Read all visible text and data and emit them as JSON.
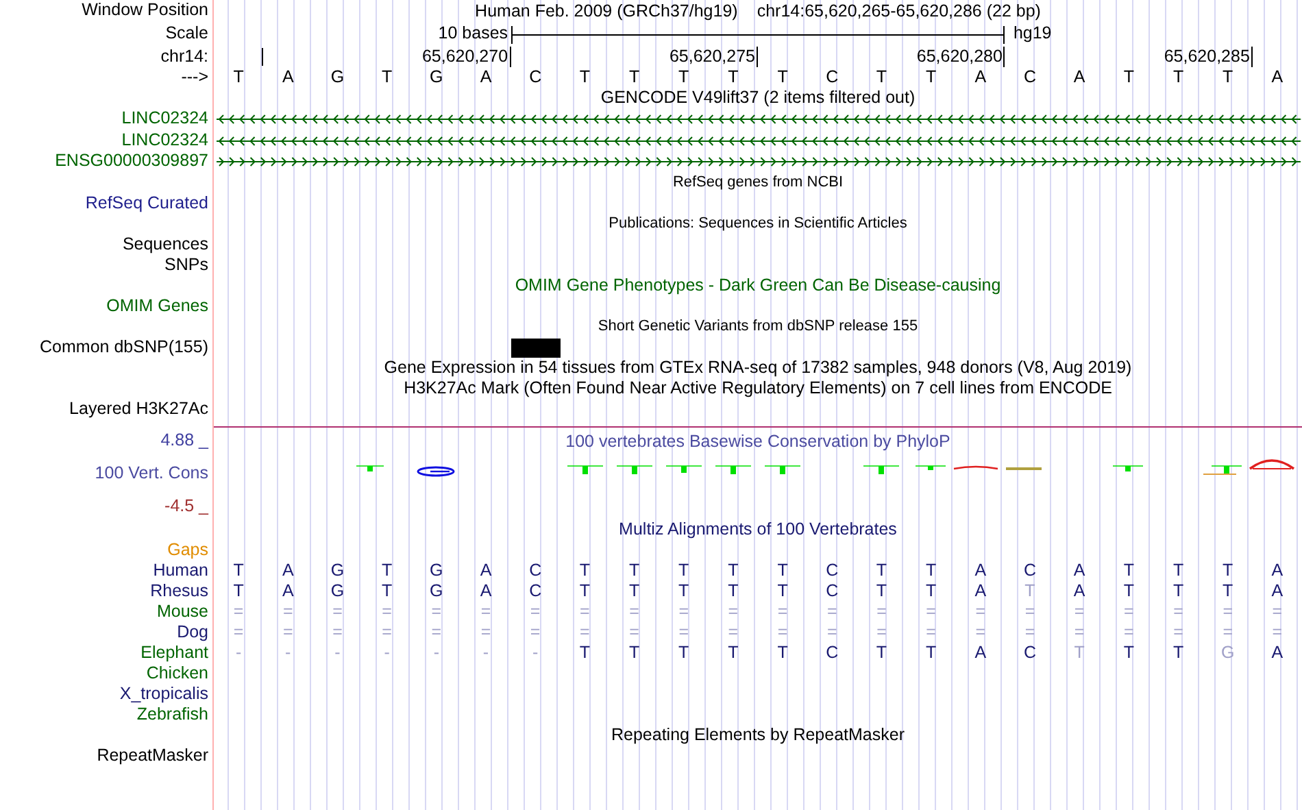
{
  "header": {
    "label": "Window Position",
    "assembly": "Human Feb. 2009 (GRCh37/hg19)",
    "position": "chr14:65,620,265-65,620,286 (22 bp)"
  },
  "scale": {
    "label": "Scale",
    "length": "10 bases",
    "assembly": "hg19"
  },
  "ruler": {
    "label": "chr14:",
    "ticks": [
      "65,620,270",
      "65,620,275",
      "65,620,280",
      "65,620,285"
    ]
  },
  "sequence": {
    "label": "--->",
    "bases": [
      "T",
      "A",
      "G",
      "T",
      "G",
      "A",
      "C",
      "T",
      "T",
      "T",
      "T",
      "T",
      "C",
      "T",
      "T",
      "A",
      "C",
      "A",
      "T",
      "T",
      "T",
      "A"
    ]
  },
  "gencode": {
    "title": "GENCODE V49lift37 (2 items filtered out)",
    "genes": [
      {
        "name": "LINC02324",
        "kind": "minus",
        "color": "#006400"
      },
      {
        "name": "LINC02324",
        "kind": "minus",
        "color": "#006400"
      },
      {
        "name": "ENSG00000309897",
        "kind": "plus",
        "color": "#006400"
      }
    ]
  },
  "tracks": [
    {
      "kind": "note",
      "titles": [
        {
          "text": "RefSeq genes from NCBI",
          "color": "#000000"
        }
      ],
      "labels": [
        {
          "text": "RefSeq Curated",
          "color": "#1e1e8c",
          "kind": "plain"
        }
      ]
    },
    {
      "kind": "note",
      "titles": [
        {
          "text": "Publications: Sequences in Scientific Articles",
          "color": "#000000"
        }
      ],
      "labels": [
        {
          "text": "Sequences",
          "color": "#000000",
          "kind": "plain"
        },
        {
          "text": "SNPs",
          "color": "#000000",
          "kind": "plain"
        }
      ]
    },
    {
      "kind": "heading",
      "titles": [
        {
          "text": "OMIM Gene Phenotypes - Dark Green Can Be Disease-causing",
          "color": "#006400"
        }
      ],
      "labels": [
        {
          "text": "OMIM Genes",
          "color": "#006400",
          "kind": "plain"
        }
      ]
    },
    {
      "kind": "note",
      "titles": [
        {
          "text": "Short Genetic Variants from dbSNP release 155",
          "color": "#000000"
        }
      ],
      "labels": [
        {
          "text": "Common dbSNP(155)",
          "color": "#000000",
          "kind": "variant"
        }
      ]
    },
    {
      "kind": "heading",
      "titles": [
        {
          "text": "Gene Expression in 54 tissues from GTEx RNA-seq of 17382 samples, 948 donors (V8, Aug 2019)",
          "color": "#000000"
        },
        {
          "text": "H3K27Ac Mark (Often Found Near Active Regulatory Elements) on 7 cell lines from ENCODE",
          "color": "#000000"
        }
      ],
      "labels": [
        {
          "text": "Layered H3K27Ac",
          "color": "#000000",
          "kind": "tall"
        }
      ]
    }
  ],
  "conservation": {
    "title": "100 vertebrates Basewise Conservation by PhyloP",
    "max": "4.88 _",
    "label": "100 Vert. Cons",
    "min": "-4.5 _"
  },
  "multiz": {
    "title": "Multiz Alignments of 100 Vertebrates",
    "gaps_label": "Gaps",
    "species": [
      {
        "name": "Human",
        "color": "#191970",
        "bases": [
          {
            "base": "T",
            "faint": false
          },
          {
            "base": "A",
            "faint": false
          },
          {
            "base": "G",
            "faint": false
          },
          {
            "base": "T",
            "faint": false
          },
          {
            "base": "G",
            "faint": false
          },
          {
            "base": "A",
            "faint": false
          },
          {
            "base": "C",
            "faint": false
          },
          {
            "base": "T",
            "faint": false
          },
          {
            "base": "T",
            "faint": false
          },
          {
            "base": "T",
            "faint": false
          },
          {
            "base": "T",
            "faint": false
          },
          {
            "base": "T",
            "faint": false
          },
          {
            "base": "C",
            "faint": false
          },
          {
            "base": "T",
            "faint": false
          },
          {
            "base": "T",
            "faint": false
          },
          {
            "base": "A",
            "faint": false
          },
          {
            "base": "C",
            "faint": false
          },
          {
            "base": "A",
            "faint": false
          },
          {
            "base": "T",
            "faint": false
          },
          {
            "base": "T",
            "faint": false
          },
          {
            "base": "T",
            "faint": false
          },
          {
            "base": "A",
            "faint": false
          }
        ]
      },
      {
        "name": "Rhesus",
        "color": "#191970",
        "bases": [
          {
            "base": "T",
            "faint": false
          },
          {
            "base": "A",
            "faint": false
          },
          {
            "base": "G",
            "faint": false
          },
          {
            "base": "T",
            "faint": false
          },
          {
            "base": "G",
            "faint": false
          },
          {
            "base": "A",
            "faint": false
          },
          {
            "base": "C",
            "faint": false
          },
          {
            "base": "T",
            "faint": false
          },
          {
            "base": "T",
            "faint": false
          },
          {
            "base": "T",
            "faint": false
          },
          {
            "base": "T",
            "faint": false
          },
          {
            "base": "T",
            "faint": false
          },
          {
            "base": "C",
            "faint": false
          },
          {
            "base": "T",
            "faint": false
          },
          {
            "base": "T",
            "faint": false
          },
          {
            "base": "A",
            "faint": false
          },
          {
            "base": "T",
            "faint": true
          },
          {
            "base": "A",
            "faint": false
          },
          {
            "base": "T",
            "faint": false
          },
          {
            "base": "T",
            "faint": false
          },
          {
            "base": "T",
            "faint": false
          },
          {
            "base": "A",
            "faint": false
          }
        ]
      },
      {
        "name": "Mouse",
        "color": "#006400",
        "bases": [
          {
            "base": "=",
            "faint": true
          },
          {
            "base": "=",
            "faint": true
          },
          {
            "base": "=",
            "faint": true
          },
          {
            "base": "=",
            "faint": true
          },
          {
            "base": "=",
            "faint": true
          },
          {
            "base": "=",
            "faint": true
          },
          {
            "base": "=",
            "faint": true
          },
          {
            "base": "=",
            "faint": true
          },
          {
            "base": "=",
            "faint": true
          },
          {
            "base": "=",
            "faint": true
          },
          {
            "base": "=",
            "faint": true
          },
          {
            "base": "=",
            "faint": true
          },
          {
            "base": "=",
            "faint": true
          },
          {
            "base": "=",
            "faint": true
          },
          {
            "base": "=",
            "faint": true
          },
          {
            "base": "=",
            "faint": true
          },
          {
            "base": "=",
            "faint": true
          },
          {
            "base": "=",
            "faint": true
          },
          {
            "base": "=",
            "faint": true
          },
          {
            "base": "=",
            "faint": true
          },
          {
            "base": "=",
            "faint": true
          },
          {
            "base": "=",
            "faint": true
          }
        ]
      },
      {
        "name": "Dog",
        "color": "#191970",
        "bases": [
          {
            "base": "=",
            "faint": true
          },
          {
            "base": "=",
            "faint": true
          },
          {
            "base": "=",
            "faint": true
          },
          {
            "base": "=",
            "faint": true
          },
          {
            "base": "=",
            "faint": true
          },
          {
            "base": "=",
            "faint": true
          },
          {
            "base": "=",
            "faint": true
          },
          {
            "base": "=",
            "faint": true
          },
          {
            "base": "=",
            "faint": true
          },
          {
            "base": "=",
            "faint": true
          },
          {
            "base": "=",
            "faint": true
          },
          {
            "base": "=",
            "faint": true
          },
          {
            "base": "=",
            "faint": true
          },
          {
            "base": "=",
            "faint": true
          },
          {
            "base": "=",
            "faint": true
          },
          {
            "base": "=",
            "faint": true
          },
          {
            "base": "=",
            "faint": true
          },
          {
            "base": "=",
            "faint": true
          },
          {
            "base": "=",
            "faint": true
          },
          {
            "base": "=",
            "faint": true
          },
          {
            "base": "=",
            "faint": true
          },
          {
            "base": "=",
            "faint": true
          }
        ]
      },
      {
        "name": "Elephant",
        "color": "#006400",
        "bases": [
          {
            "base": "-",
            "faint": true
          },
          {
            "base": "-",
            "faint": true
          },
          {
            "base": "-",
            "faint": true
          },
          {
            "base": "-",
            "faint": true
          },
          {
            "base": "-",
            "faint": true
          },
          {
            "base": "-",
            "faint": true
          },
          {
            "base": "-",
            "faint": true
          },
          {
            "base": "T",
            "faint": false
          },
          {
            "base": "T",
            "faint": false
          },
          {
            "base": "T",
            "faint": false
          },
          {
            "base": "T",
            "faint": false
          },
          {
            "base": "T",
            "faint": false
          },
          {
            "base": "C",
            "faint": false
          },
          {
            "base": "T",
            "faint": false
          },
          {
            "base": "T",
            "faint": false
          },
          {
            "base": "A",
            "faint": false
          },
          {
            "base": "C",
            "faint": false
          },
          {
            "base": "T",
            "faint": true
          },
          {
            "base": "T",
            "faint": false
          },
          {
            "base": "T",
            "faint": false
          },
          {
            "base": "G",
            "faint": true
          },
          {
            "base": "A",
            "faint": false
          }
        ]
      },
      {
        "name": "Chicken",
        "color": "#006400"
      },
      {
        "name": "X_tropicalis",
        "color": "#191970"
      },
      {
        "name": "Zebrafish",
        "color": "#006400"
      }
    ]
  },
  "repeats": {
    "title": "Repeating Elements by RepeatMasker",
    "label": "RepeatMasker"
  }
}
